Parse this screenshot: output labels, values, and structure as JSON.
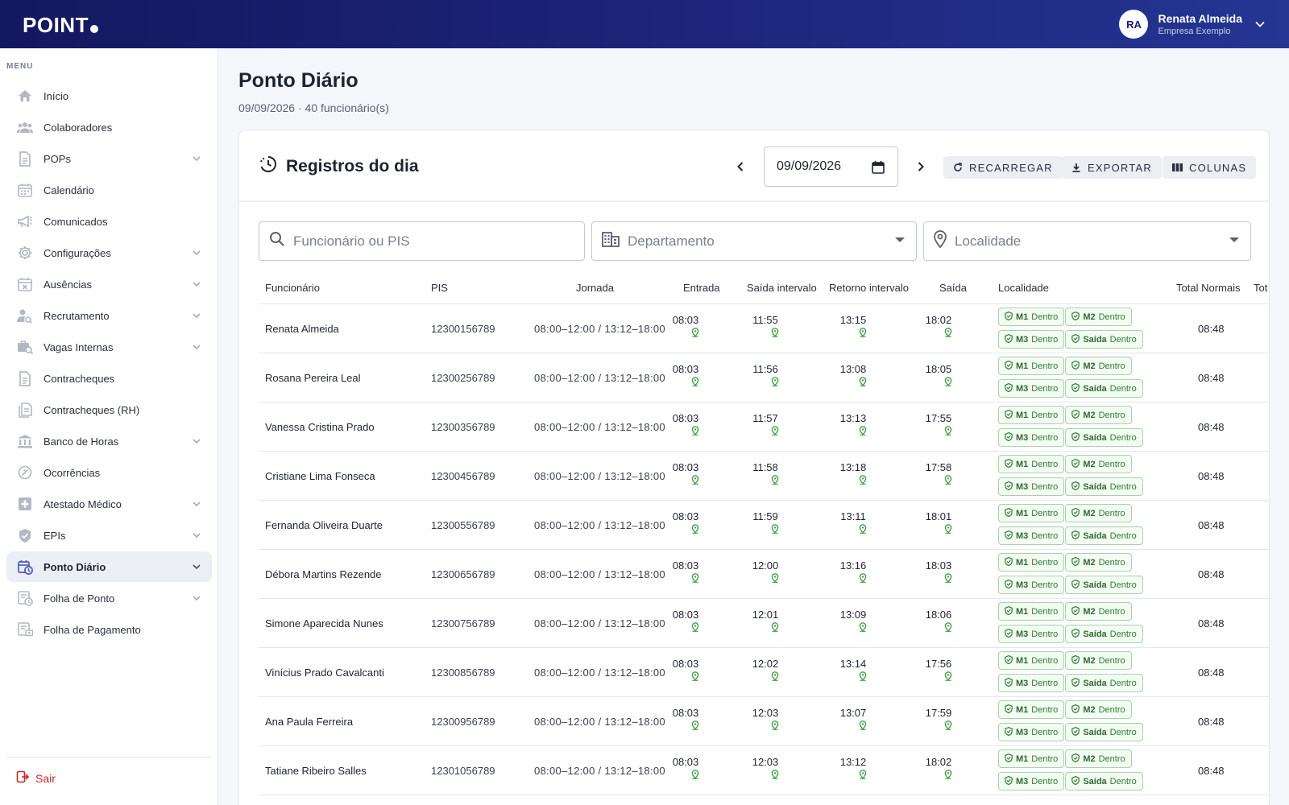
{
  "app": {
    "logo": "POINT",
    "user": {
      "initials": "RA",
      "name": "Renata Almeida",
      "company": "Empresa Exemplo"
    }
  },
  "sidebar": {
    "menu_label": "MENU",
    "items": [
      {
        "label": "Início",
        "icon": "home-icon",
        "chevron": false
      },
      {
        "label": "Colaboradores",
        "icon": "people-icon",
        "chevron": false
      },
      {
        "label": "POPs",
        "icon": "document-icon",
        "chevron": true
      },
      {
        "label": "Calendário",
        "icon": "calendar-icon",
        "chevron": false
      },
      {
        "label": "Comunicados",
        "icon": "megaphone-icon",
        "chevron": false
      },
      {
        "label": "Configurações",
        "icon": "gear-icon",
        "chevron": true
      },
      {
        "label": "Ausências",
        "icon": "calendar-x-icon",
        "chevron": true
      },
      {
        "label": "Recrutamento",
        "icon": "person-search-icon",
        "chevron": true
      },
      {
        "label": "Vagas Internas",
        "icon": "job-search-icon",
        "chevron": true
      },
      {
        "label": "Contracheques",
        "icon": "paycheck-icon",
        "chevron": false
      },
      {
        "label": "Contracheques (RH)",
        "icon": "paycheck-rh-icon",
        "chevron": false
      },
      {
        "label": "Banco de Horas",
        "icon": "bank-icon",
        "chevron": true
      },
      {
        "label": "Ocorrências",
        "icon": "occurrence-icon",
        "chevron": false
      },
      {
        "label": "Atestado Médico",
        "icon": "medical-icon",
        "chevron": true
      },
      {
        "label": "EPIs",
        "icon": "shield-icon",
        "chevron": true
      },
      {
        "label": "Ponto Diário",
        "icon": "clock-calendar-icon",
        "chevron": true,
        "active": true
      },
      {
        "label": "Folha de Ponto",
        "icon": "timesheet-icon",
        "chevron": true
      },
      {
        "label": "Folha de Pagamento",
        "icon": "payroll-icon",
        "chevron": false
      }
    ],
    "logout_label": "Sair"
  },
  "page": {
    "title": "Ponto Diário",
    "subtitle": "09/09/2026 · 40 funcionário(s)"
  },
  "card": {
    "title": "Registros do dia",
    "date_value": "09/09/2026",
    "buttons": {
      "reload": "RECARREGAR",
      "export": "EXPORTAR",
      "columns": "COLUNAS"
    },
    "filters": {
      "search_placeholder": "Funcionário ou PIS",
      "department_placeholder": "Departamento",
      "locality_placeholder": "Localidade"
    }
  },
  "table": {
    "headers": {
      "funcionario": "Funcionário",
      "pis": "PIS",
      "jornada": "Jornada",
      "entrada": "Entrada",
      "saida_intervalo": "Saída intervalo",
      "retorno_intervalo": "Retorno intervalo",
      "saida": "Saída",
      "localidade": "Localidade",
      "total_normais": "Total Normais",
      "total_extra": "Tot"
    },
    "chip_status": "Dentro",
    "chip_labels": [
      "M1",
      "M2",
      "M3",
      "Saída"
    ],
    "rows": [
      {
        "name": "Renata Almeida",
        "pis": "12300156789",
        "jornada": "08:00–12:00 / 13:12–18:00",
        "entrada": "08:03",
        "saida_int": "11:55",
        "retorno": "13:15",
        "saida": "18:02",
        "total": "08:48"
      },
      {
        "name": "Rosana Pereira Leal",
        "pis": "12300256789",
        "jornada": "08:00–12:00 / 13:12–18:00",
        "entrada": "08:03",
        "saida_int": "11:56",
        "retorno": "13:08",
        "saida": "18:05",
        "total": "08:48"
      },
      {
        "name": "Vanessa Cristina Prado",
        "pis": "12300356789",
        "jornada": "08:00–12:00 / 13:12–18:00",
        "entrada": "08:03",
        "saida_int": "11:57",
        "retorno": "13:13",
        "saida": "17:55",
        "total": "08:48"
      },
      {
        "name": "Cristiane Lima Fonseca",
        "pis": "12300456789",
        "jornada": "08:00–12:00 / 13:12–18:00",
        "entrada": "08:03",
        "saida_int": "11:58",
        "retorno": "13:18",
        "saida": "17:58",
        "total": "08:48"
      },
      {
        "name": "Fernanda Oliveira Duarte",
        "pis": "12300556789",
        "jornada": "08:00–12:00 / 13:12–18:00",
        "entrada": "08:03",
        "saida_int": "11:59",
        "retorno": "13:11",
        "saida": "18:01",
        "total": "08:48"
      },
      {
        "name": "Débora Martins Rezende",
        "pis": "12300656789",
        "jornada": "08:00–12:00 / 13:12–18:00",
        "entrada": "08:03",
        "saida_int": "12:00",
        "retorno": "13:16",
        "saida": "18:03",
        "total": "08:48"
      },
      {
        "name": "Simone Aparecida Nunes",
        "pis": "12300756789",
        "jornada": "08:00–12:00 / 13:12–18:00",
        "entrada": "08:03",
        "saida_int": "12:01",
        "retorno": "13:09",
        "saida": "18:06",
        "total": "08:48"
      },
      {
        "name": "Vinícius Prado Cavalcanti",
        "pis": "12300856789",
        "jornada": "08:00–12:00 / 13:12–18:00",
        "entrada": "08:03",
        "saida_int": "12:02",
        "retorno": "13:14",
        "saida": "17:56",
        "total": "08:48"
      },
      {
        "name": "Ana Paula Ferreira",
        "pis": "12300956789",
        "jornada": "08:00–12:00 / 13:12–18:00",
        "entrada": "08:03",
        "saida_int": "12:03",
        "retorno": "13:07",
        "saida": "17:59",
        "total": "08:48"
      },
      {
        "name": "Tatiane Ribeiro Salles",
        "pis": "12301056789",
        "jornada": "08:00–12:00 / 13:12–18:00",
        "entrada": "08:03",
        "saida_int": "12:03",
        "retorno": "13:12",
        "saida": "18:02",
        "total": "08:48"
      }
    ]
  },
  "colors": {
    "topbar_start": "#14185f",
    "topbar_end": "#243592",
    "accent": "#4a5dbf",
    "chip_green": "#2e7d32",
    "logout_red": "#c62828"
  }
}
